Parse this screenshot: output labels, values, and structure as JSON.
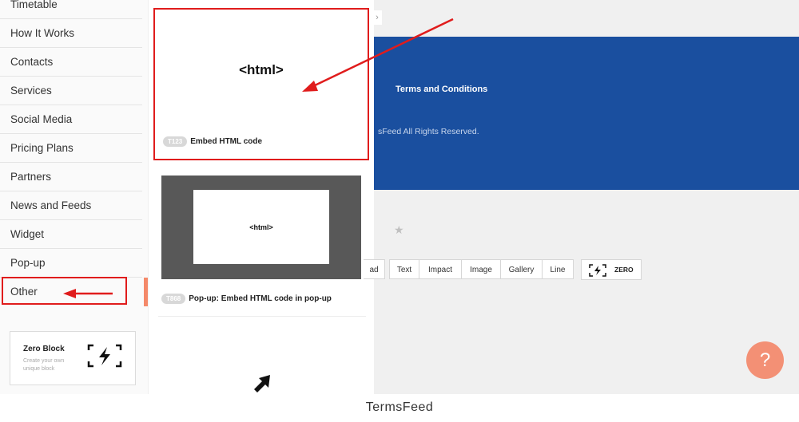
{
  "sidebar": {
    "categories": [
      {
        "label": "Timetable"
      },
      {
        "label": "How It Works"
      },
      {
        "label": "Contacts"
      },
      {
        "label": "Services"
      },
      {
        "label": "Social Media"
      },
      {
        "label": "Pricing Plans"
      },
      {
        "label": "Partners"
      },
      {
        "label": "News and Feeds"
      },
      {
        "label": "Widget"
      },
      {
        "label": "Pop-up"
      },
      {
        "label": "Other"
      }
    ],
    "active_category": "Other",
    "zero_block": {
      "title": "Zero Block",
      "subtitle": "Create your own unique block"
    }
  },
  "block_panel": {
    "cards": [
      {
        "code": "T123",
        "label": "Embed HTML code",
        "preview_text": "<html>"
      },
      {
        "code": "T868",
        "label": "Pop-up: Embed HTML code in pop-up",
        "preview_text": "<html>"
      }
    ]
  },
  "page": {
    "banner": {
      "title": "Terms and Conditions",
      "copyright": "sFeed All Rights Reserved."
    },
    "toolbar_buttons": [
      "ad",
      "Text",
      "Impact",
      "Image",
      "Gallery",
      "Line"
    ],
    "zero_button_label": "ZERO",
    "help_label": "?"
  },
  "annotations": {
    "highlight_color": "#e01c1c"
  },
  "colors": {
    "banner_blue": "#1a4f9f",
    "accent_orange": "#f39075"
  },
  "caption": "TermsFeed"
}
